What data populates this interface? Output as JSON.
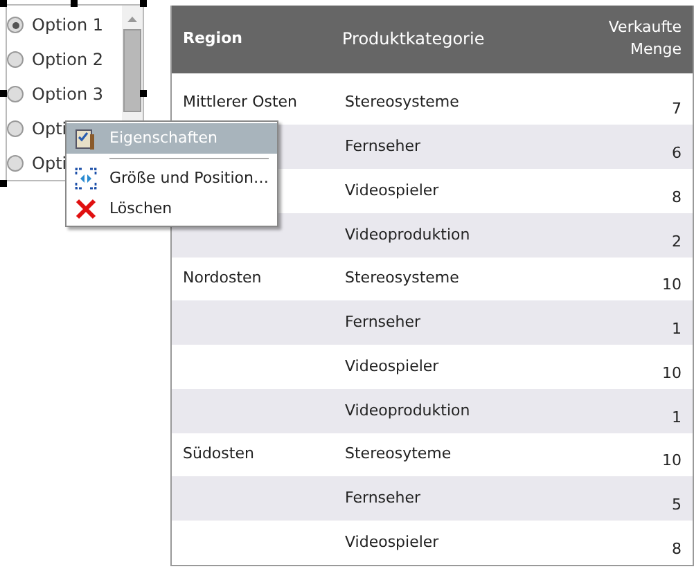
{
  "radio_list": {
    "options": [
      {
        "label": "Option 1",
        "selected": true
      },
      {
        "label": "Option 2",
        "selected": false
      },
      {
        "label": "Option 3",
        "selected": false
      },
      {
        "label": "Opti",
        "selected": false
      },
      {
        "label": "Opti",
        "selected": false
      }
    ]
  },
  "context_menu": {
    "items": [
      {
        "kind": "item",
        "label": "Eigenschaften",
        "selected": true
      },
      {
        "kind": "separator"
      },
      {
        "kind": "item",
        "label": "Größe und Position…",
        "selected": false
      },
      {
        "kind": "item",
        "label": "Löschen",
        "selected": false
      }
    ]
  },
  "table": {
    "columns": [
      "Region",
      "Produktkategorie",
      "Verkaufte Menge"
    ],
    "rows": [
      [
        "Mittlerer Osten",
        "Stereosysteme",
        "7"
      ],
      [
        "",
        "Fernseher",
        "6"
      ],
      [
        "",
        "Videospieler",
        "8"
      ],
      [
        "",
        "Videoproduktion",
        "2"
      ],
      [
        "Nordosten",
        "Stereosysteme",
        "10"
      ],
      [
        "",
        "Fernseher",
        "1"
      ],
      [
        "",
        "Videospieler",
        "10"
      ],
      [
        "",
        "Videoproduktion",
        "1"
      ],
      [
        "Südosten",
        "Stereosyteme",
        "10"
      ],
      [
        "",
        "Fernseher",
        "5"
      ],
      [
        "",
        "Videospieler",
        "8"
      ]
    ]
  }
}
